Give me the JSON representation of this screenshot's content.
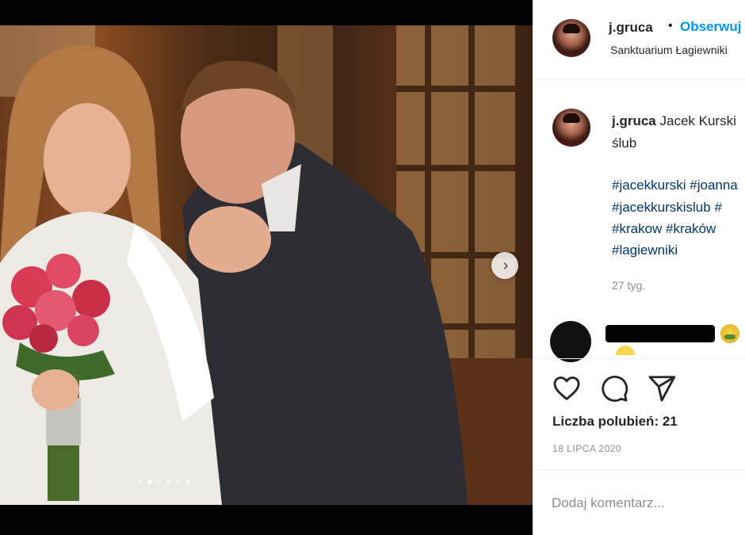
{
  "post": {
    "username": "j.gruca",
    "separator": "•",
    "follow_label": "Obserwuj",
    "location": "Sanktuarium Łagiewniki",
    "caption": {
      "username": "j.gruca",
      "text_start": "Jacek Kurski",
      "text_line2": "ślub",
      "hashtag_lines": [
        "#jacekkurski #joanna",
        "#jacekkurskislub #",
        "#krakow #kraków",
        "#lagiewniki"
      ]
    },
    "time_ago": "27 tyg.",
    "likes_label": "Liczba polubień: 21",
    "date": "18 LIPCA 2020",
    "comment_placeholder": "Dodaj komentarz..."
  },
  "carousel": {
    "total_slides": 6,
    "active_index": 1,
    "next_symbol": "›"
  },
  "icons": {
    "like": "heart-icon",
    "comment": "comment-bubble-icon",
    "share": "paper-plane-icon",
    "next": "chevron-right-icon"
  },
  "colors": {
    "link": "#0095f6",
    "hashtag": "#00376b",
    "muted": "#8e8e8e"
  }
}
